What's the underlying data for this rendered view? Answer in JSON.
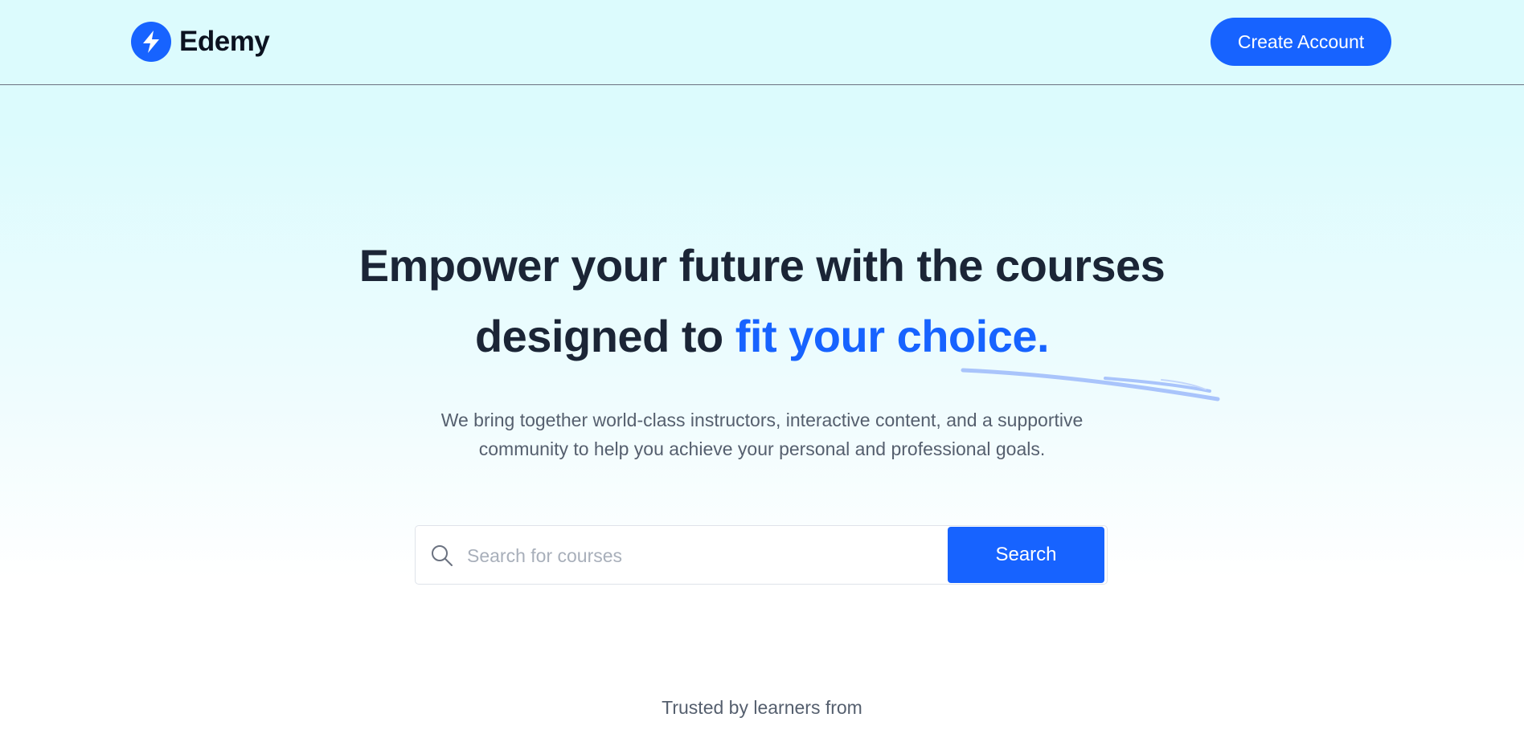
{
  "brand": {
    "name": "Edemy",
    "logo_icon": "lightning-bolt-icon",
    "accent_color": "#1763ff"
  },
  "nav": {
    "create_account_label": "Create Account"
  },
  "hero": {
    "title_line1": "Empower your future with the courses",
    "title_line2_plain": "designed to ",
    "title_line2_accent": "fit your choice.",
    "subtitle": "We bring together world-class instructors, interactive content, and a supportive community to help you achieve your personal and professional goals."
  },
  "search": {
    "placeholder": "Search for courses",
    "icon": "search-icon",
    "button_label": "Search"
  },
  "trusted": {
    "label": "Trusted by learners from"
  }
}
